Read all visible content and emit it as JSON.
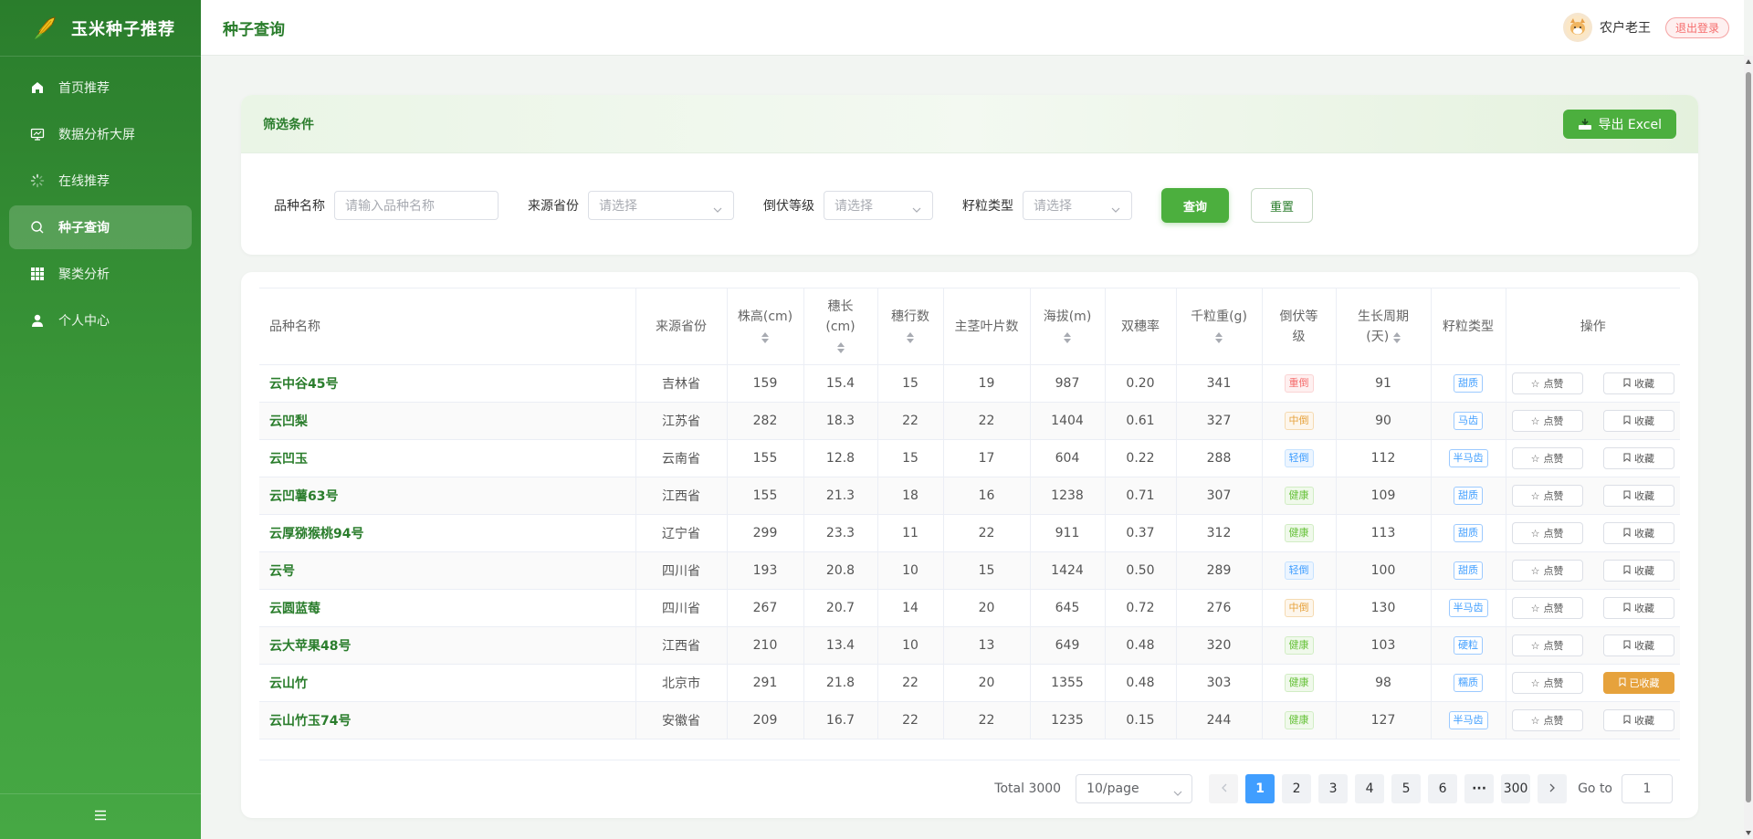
{
  "app": {
    "title": "玉米种子推荐"
  },
  "sidebar": {
    "items": [
      {
        "label": "首页推荐",
        "icon": "home-icon"
      },
      {
        "label": "数据分析大屏",
        "icon": "monitor-icon"
      },
      {
        "label": "在线推荐",
        "icon": "loading-icon"
      },
      {
        "label": "种子查询",
        "icon": "search-icon",
        "active": true
      },
      {
        "label": "聚类分析",
        "icon": "grid-icon"
      },
      {
        "label": "个人中心",
        "icon": "user-icon"
      }
    ],
    "collapse_icon": "menu-fold-icon"
  },
  "header": {
    "page_title": "种子查询",
    "username": "农户老王",
    "logout_label": "退出登录"
  },
  "filter": {
    "title": "筛选条件",
    "export_label": "导出 Excel",
    "variety_label": "品种名称",
    "variety_placeholder": "请输入品种名称",
    "province_label": "来源省份",
    "province_placeholder": "请选择",
    "lodging_label": "倒伏等级",
    "lodging_placeholder": "请选择",
    "kernel_label": "籽粒类型",
    "kernel_placeholder": "请选择",
    "query_label": "查询",
    "reset_label": "重置"
  },
  "table": {
    "columns": {
      "name": "品种名称",
      "province": "来源省份",
      "height": "株高(cm)",
      "ear_len_a": "穗长",
      "ear_len_b": "(cm)",
      "rows": "穗行数",
      "leaves": "主茎叶片数",
      "altitude": "海拔(m)",
      "double_ear": "双穗率",
      "kernel_weight": "千粒重(g)",
      "lodging_a": "倒伏等",
      "lodging_b": "级",
      "growth_a": "生长周期",
      "growth_b": "(天)",
      "kernel_type": "籽粒类型",
      "actions": "操作"
    },
    "like_label": "点赞",
    "fav_label": "收藏",
    "faved_label": "已收藏",
    "rows": [
      {
        "name": "云中谷45号",
        "province": "吉林省",
        "height": "159",
        "ear_len": "15.4",
        "rows": "15",
        "leaves": "19",
        "altitude": "987",
        "double_ear": "0.20",
        "kernel_weight": "341",
        "lodging": "重倒",
        "lodging_color": "red",
        "growth": "91",
        "kernel_type": "甜质",
        "faved": false
      },
      {
        "name": "云凹梨",
        "province": "江苏省",
        "height": "282",
        "ear_len": "18.3",
        "rows": "22",
        "leaves": "22",
        "altitude": "1404",
        "double_ear": "0.61",
        "kernel_weight": "327",
        "lodging": "中倒",
        "lodging_color": "orange",
        "growth": "90",
        "kernel_type": "马齿",
        "faved": false
      },
      {
        "name": "云凹玉",
        "province": "云南省",
        "height": "155",
        "ear_len": "12.8",
        "rows": "15",
        "leaves": "17",
        "altitude": "604",
        "double_ear": "0.22",
        "kernel_weight": "288",
        "lodging": "轻倒",
        "lodging_color": "blue",
        "growth": "112",
        "kernel_type": "半马齿",
        "faved": false
      },
      {
        "name": "云凹薯63号",
        "province": "江西省",
        "height": "155",
        "ear_len": "21.3",
        "rows": "18",
        "leaves": "16",
        "altitude": "1238",
        "double_ear": "0.71",
        "kernel_weight": "307",
        "lodging": "健康",
        "lodging_color": "green",
        "growth": "109",
        "kernel_type": "甜质",
        "faved": false
      },
      {
        "name": "云厚猕猴桃94号",
        "province": "辽宁省",
        "height": "299",
        "ear_len": "23.3",
        "rows": "11",
        "leaves": "22",
        "altitude": "911",
        "double_ear": "0.37",
        "kernel_weight": "312",
        "lodging": "健康",
        "lodging_color": "green",
        "growth": "113",
        "kernel_type": "甜质",
        "faved": false
      },
      {
        "name": "云号",
        "province": "四川省",
        "height": "193",
        "ear_len": "20.8",
        "rows": "10",
        "leaves": "15",
        "altitude": "1424",
        "double_ear": "0.50",
        "kernel_weight": "289",
        "lodging": "轻倒",
        "lodging_color": "blue",
        "growth": "100",
        "kernel_type": "甜质",
        "faved": false
      },
      {
        "name": "云圆蓝莓",
        "province": "四川省",
        "height": "267",
        "ear_len": "20.7",
        "rows": "14",
        "leaves": "20",
        "altitude": "645",
        "double_ear": "0.72",
        "kernel_weight": "276",
        "lodging": "中倒",
        "lodging_color": "orange",
        "growth": "130",
        "kernel_type": "半马齿",
        "faved": false
      },
      {
        "name": "云大苹果48号",
        "province": "江西省",
        "height": "210",
        "ear_len": "13.4",
        "rows": "10",
        "leaves": "13",
        "altitude": "649",
        "double_ear": "0.48",
        "kernel_weight": "320",
        "lodging": "健康",
        "lodging_color": "green",
        "growth": "103",
        "kernel_type": "硬粒",
        "faved": false
      },
      {
        "name": "云山竹",
        "province": "北京市",
        "height": "291",
        "ear_len": "21.8",
        "rows": "22",
        "leaves": "20",
        "altitude": "1355",
        "double_ear": "0.48",
        "kernel_weight": "303",
        "lodging": "健康",
        "lodging_color": "green",
        "growth": "98",
        "kernel_type": "糯质",
        "faved": true
      },
      {
        "name": "云山竹玉74号",
        "province": "安徽省",
        "height": "209",
        "ear_len": "16.7",
        "rows": "22",
        "leaves": "22",
        "altitude": "1235",
        "double_ear": "0.15",
        "kernel_weight": "244",
        "lodging": "健康",
        "lodging_color": "green",
        "growth": "127",
        "kernel_type": "半马齿",
        "faved": false
      }
    ]
  },
  "pagination": {
    "total_text": "Total 3000",
    "page_size": "10/page",
    "pages": [
      "1",
      "2",
      "3",
      "4",
      "5",
      "6"
    ],
    "ellipsis": "···",
    "last_page": "300",
    "current": "1",
    "goto_label": "Go to",
    "goto_value": "1"
  },
  "colors": {
    "brand_green": "#2a7d2c",
    "button_green": "#4caf3e",
    "pager_active": "#409eff",
    "faved_orange": "#e6a23c"
  }
}
